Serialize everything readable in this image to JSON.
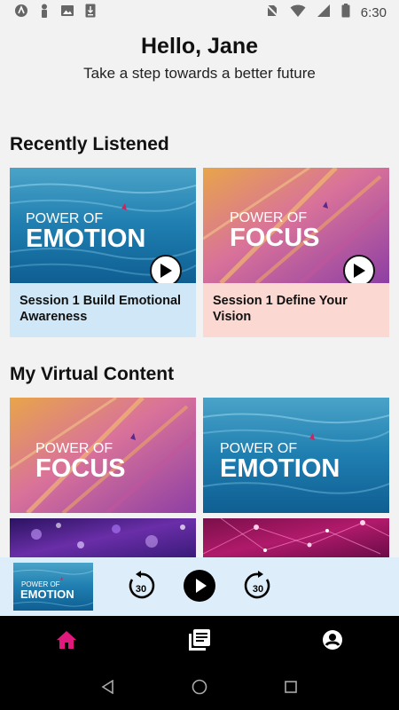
{
  "status_bar": {
    "time": "6:30",
    "left_icons": [
      "app-notification-icon",
      "person-notification-icon",
      "image-notification-icon",
      "download-notification-icon"
    ],
    "right_icons": [
      "no-sim-icon",
      "wifi-icon",
      "signal-icon",
      "battery-icon"
    ]
  },
  "greeting": {
    "title": "Hello, Jane",
    "subtitle": "Take a step towards a better future"
  },
  "recently_listened": {
    "title": "Recently Listened",
    "items": [
      {
        "program_line1": "POWER OF",
        "program_line2": "EMOTION",
        "title": "Session 1 Build Emotional Awareness",
        "theme": "emotion"
      },
      {
        "program_line1": "POWER OF",
        "program_line2": "FOCUS",
        "title": "Session 1 Define Your Vision",
        "theme": "focus"
      }
    ]
  },
  "virtual_content": {
    "title": "My Virtual Content",
    "items": [
      {
        "program_line1": "POWER OF",
        "program_line2": "FOCUS",
        "theme": "focus"
      },
      {
        "program_line1": "POWER OF",
        "program_line2": "EMOTION",
        "theme": "emotion"
      },
      {
        "theme": "purple-lights"
      },
      {
        "theme": "magenta-lights"
      }
    ]
  },
  "mini_player": {
    "program_line1": "POWER OF",
    "program_line2": "EMOTION",
    "rewind_label": "30",
    "forward_label": "30"
  },
  "bottom_nav": {
    "items": [
      {
        "name": "home",
        "icon": "home-icon",
        "active": true
      },
      {
        "name": "library",
        "icon": "library-icon",
        "active": false
      },
      {
        "name": "profile",
        "icon": "account-icon",
        "active": false
      }
    ],
    "active_color": "#e0197d"
  },
  "colors": {
    "caption_blue": "#cfe7f6",
    "caption_pink": "#fbd8d1",
    "player_bg": "#ddeefa",
    "accent": "#e0197d"
  }
}
